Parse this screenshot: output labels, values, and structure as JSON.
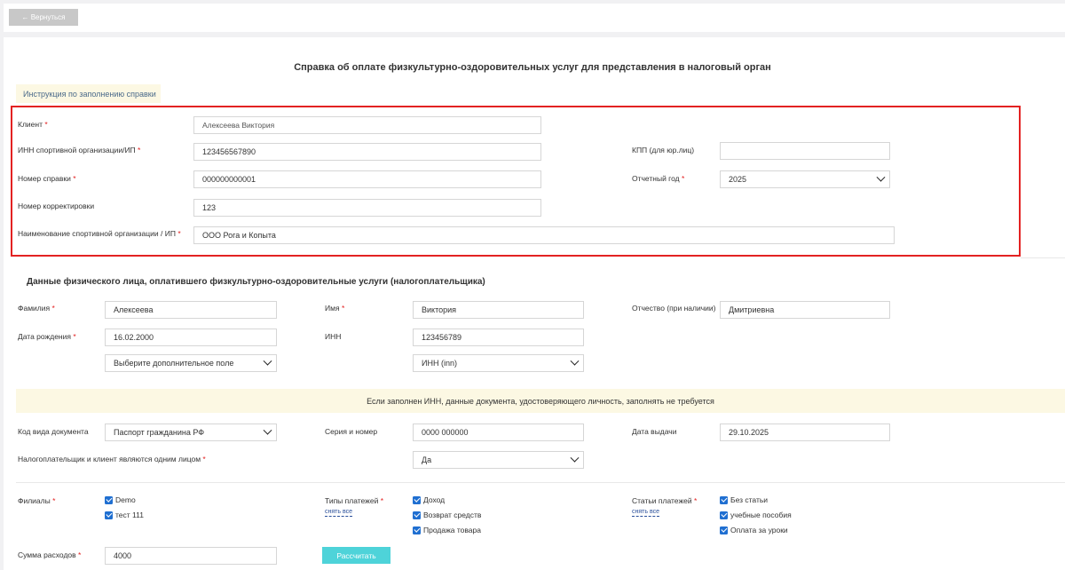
{
  "nav": {
    "back_label": "← Вернуться"
  },
  "page": {
    "title": "Справка об оплате физкультурно-оздоровительных услуг для представления в налоговый орган",
    "instruction_link": "Инструкция по заполнению справки"
  },
  "required_mark": "*",
  "certificate": {
    "client": {
      "label": "Клиент",
      "value": "Алексеева Виктория"
    },
    "inn_org": {
      "label": "ИНН спортивной организации/ИП",
      "value": "123456567890"
    },
    "kpp": {
      "label": "КПП (для юр.лиц)",
      "value": ""
    },
    "number": {
      "label": "Номер справки",
      "value": "000000000001"
    },
    "year": {
      "label": "Отчетный год",
      "value": "2025"
    },
    "correction": {
      "label": "Номер корректировки",
      "value": "123"
    },
    "org_name": {
      "label": "Наименование спортивной организации / ИП",
      "value": "ООО Рога и Копыта"
    }
  },
  "payer": {
    "section_title": "Данные физического лица, оплатившего физкультурно-оздоровительные услуги (налогоплательщика)",
    "last_name": {
      "label": "Фамилия",
      "value": "Алексеева"
    },
    "first_name": {
      "label": "Имя",
      "value": "Виктория"
    },
    "patronymic": {
      "label": "Отчество (при наличии)",
      "value": "Дмитриевна"
    },
    "birth_date": {
      "label": "Дата рождения",
      "value": "16.02.2000"
    },
    "inn": {
      "label": "ИНН",
      "value": "123456789"
    },
    "extra_field_select": "Выберите дополнительное поле",
    "inn_type_select": "ИНН (inn)"
  },
  "notice": "Если заполнен ИНН, данные документа, удостоверяющего личность, заполнять не требуется",
  "document": {
    "type": {
      "label": "Код вида документа",
      "value": "Паспорт гражданина РФ"
    },
    "series_number": {
      "label": "Серия и номер",
      "value": "0000 000000"
    },
    "issue_date": {
      "label": "Дата выдачи",
      "value": "29.10.2025"
    },
    "same_person": {
      "label": "Налогоплательщик и клиент являются одним лицом",
      "value": "Да"
    }
  },
  "filters": {
    "branches": {
      "label": "Филиалы",
      "items": [
        "Demo",
        "тест 111"
      ]
    },
    "payment_types": {
      "label": "Типы платежей",
      "unselect": "снять все",
      "items": [
        "Доход",
        "Возврат средств",
        "Продажа товара"
      ]
    },
    "payment_items": {
      "label": "Статьи платежей",
      "unselect": "снять все",
      "items": [
        "Без статьи",
        "учебные пособия",
        "Оплата за уроки"
      ]
    }
  },
  "expenses": {
    "label": "Сумма расходов",
    "value": "4000",
    "calc_button": "Рассчитать"
  }
}
